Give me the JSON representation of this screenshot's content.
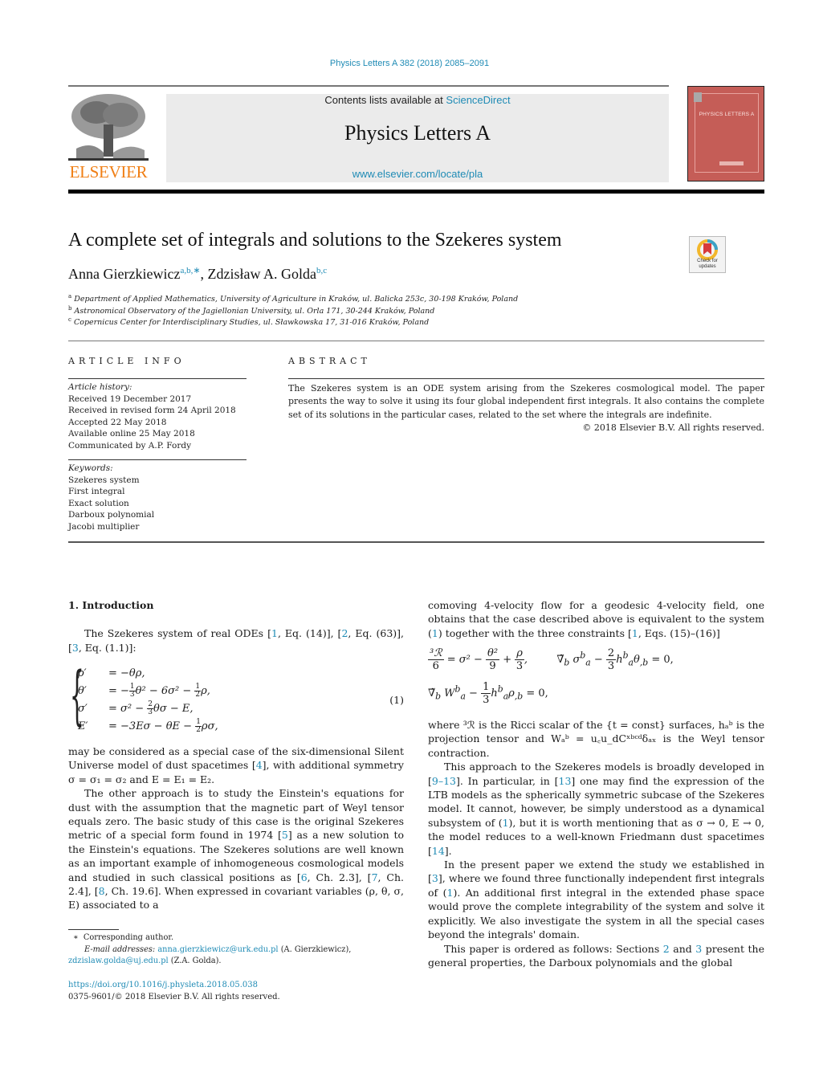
{
  "header": {
    "journal_reference": "Physics Letters A 382 (2018) 2085–2091",
    "contents_prefix": "Contents lists available at ",
    "contents_link": "ScienceDirect",
    "journal_name": "Physics Letters A",
    "journal_url": "www.elsevier.com/locate/pla",
    "publisher_logo_text": "ELSEVIER",
    "cover_title": "PHYSICS LETTERS A",
    "check_updates_label": "Check for updates"
  },
  "article": {
    "title": "A complete set of integrals and solutions to the Szekeres system",
    "authors": [
      {
        "name": "Anna Gierzkiewicz",
        "affiliations": "a,b,∗"
      },
      {
        "name": "Zdzisław A. Golda",
        "affiliations": "b,c"
      }
    ],
    "author_separator": ", ",
    "affiliations": [
      {
        "key": "a",
        "text": "Department of Applied Mathematics, University of Agriculture in Kraków, ul. Balicka 253c, 30-198 Kraków, Poland"
      },
      {
        "key": "b",
        "text": "Astronomical Observatory of the Jagiellonian University, ul. Orla 171, 30-244 Kraków, Poland"
      },
      {
        "key": "c",
        "text": "Copernicus Center for Interdisciplinary Studies, ul. Sławkowska 17, 31-016 Kraków, Poland"
      }
    ]
  },
  "article_info": {
    "heading": "ARTICLE INFO",
    "history_label": "Article history:",
    "history": [
      "Received 19 December 2017",
      "Received in revised form 24 April 2018",
      "Accepted 22 May 2018",
      "Available online 25 May 2018",
      "Communicated by A.P. Fordy"
    ],
    "keywords_label": "Keywords:",
    "keywords": [
      "Szekeres system",
      "First integral",
      "Exact solution",
      "Darboux polynomial",
      "Jacobi multiplier"
    ]
  },
  "abstract": {
    "heading": "ABSTRACT",
    "text": "The Szekeres system is an ODE system arising from the Szekeres cosmological model. The paper presents the way to solve it using its four global independent first integrals. It also contains the complete set of its solutions in the particular cases, related to the set where the integrals are indefinite.",
    "copyright": "© 2018 Elsevier B.V. All rights reserved."
  },
  "body": {
    "section_heading": "1. Introduction",
    "p1_before": "The Szekeres system of real ODEs [",
    "p1_ref1": "1",
    "p1_mid1": ", Eq. (14)], [",
    "p1_ref2": "2",
    "p1_mid2": ", Eq. (63)], [",
    "p1_ref3": "3",
    "p1_after": ", Eq. (1.1)]:",
    "equation_system": {
      "rows": [
        {
          "lhs": "ρ′",
          "rhs": "= −θρ,"
        },
        {
          "lhs": "θ′",
          "rhs_parts": [
            "= −",
            "1",
            "3",
            "θ² − 6σ² − ",
            "1",
            "2",
            "ρ,"
          ]
        },
        {
          "lhs": "σ′",
          "rhs_parts": [
            "= σ² − ",
            "2",
            "3",
            "θσ − E,"
          ]
        },
        {
          "lhs": "E′",
          "rhs_parts": [
            "= −3Eσ − θE − ",
            "1",
            "2",
            "ρσ,"
          ]
        }
      ],
      "number": "(1)"
    },
    "p2_a": "may be considered as a special case of the six-dimensional Silent Universe model of dust spacetimes [",
    "p2_ref": "4",
    "p2_b": "], with additional symmetry σ = σ₁ = σ₂ and E = E₁ = E₂.",
    "p3_a": "The other approach is to study the Einstein's equations for dust with the assumption that the magnetic part of Weyl tensor equals zero. The basic study of this case is the original Szekeres metric of a special form found in 1974 [",
    "p3_ref5": "5",
    "p3_b": "] as a new solution to the Einstein's equations. The Szekeres solutions are well known as an important example of inhomogeneous cosmological models and studied in such classical positions as [",
    "p3_ref6": "6",
    "p3_c": ", Ch. 2.3], [",
    "p3_ref7": "7",
    "p3_d": ", Ch. 2.4], [",
    "p3_ref8": "8",
    "p3_e": ", Ch. 19.6]. When expressed in covariant variables (ρ, θ, σ, E) associated to a",
    "r1_a": "comoving 4-velocity flow for a geodesic 4-velocity field, one obtains that the case described above is equivalent to the system (",
    "r1_ref": "1",
    "r1_b": ") together with the three constraints [",
    "r1_ref2": "1",
    "r1_c": ", Eqs. (15)–(16)]",
    "constraint1_parts": [
      "³ℛ",
      "6",
      "= σ² − ",
      "θ²",
      "9",
      " + ",
      "ρ",
      "3",
      ","
    ],
    "constraint2_parts": [
      "∇̃",
      "b",
      " σ",
      "a",
      "b",
      " − ",
      "2",
      "3",
      "h",
      "a",
      "b",
      "θ",
      ",b",
      " = 0,"
    ],
    "constraint3_parts": [
      "∇̃",
      "b",
      " W",
      "a",
      "b",
      " − ",
      "1",
      "3",
      "h",
      "a",
      "b",
      "ρ",
      ",b",
      " = 0,"
    ],
    "r2": "where ³ℛ is the Ricci scalar of the {t = const} surfaces, hₐᵇ is the projection tensor and Wₐᵇ = u꜀u_dCˣᵇᶜᵈδₐₓ is the Weyl tensor contraction.",
    "r3_a": "This approach to the Szekeres models is broadly developed in [",
    "r3_ref1": "9–13",
    "r3_b": "]. In particular, in [",
    "r3_ref2": "13",
    "r3_c": "] one may find the expression of the LTB models as the spherically symmetric subcase of the Szekeres model. It cannot, however, be simply understood as a dynamical subsystem of (",
    "r3_ref3": "1",
    "r3_d": "), but it is worth mentioning that as σ → 0, E → 0, the model reduces to a well-known Friedmann dust spacetimes [",
    "r3_ref4": "14",
    "r3_e": "].",
    "r4_a": "In the present paper we extend the study we established in [",
    "r4_ref1": "3",
    "r4_b": "], where we found three functionally independent first integrals of (",
    "r4_ref2": "1",
    "r4_c": "). An additional first integral in the extended phase space would prove the complete integrability of the system and solve it explicitly. We also investigate the system in all the special cases beyond the integrals' domain.",
    "r5_a": "This paper is ordered as follows: Sections ",
    "r5_ref1": "2",
    "r5_b": " and ",
    "r5_ref2": "3",
    "r5_c": " present the general properties, the Darboux polynomials and the global"
  },
  "footnotes": {
    "star": "∗",
    "corresponding": "Corresponding author.",
    "email_label": "E-mail addresses:",
    "email1": "anna.gierzkiewicz@urk.edu.pl",
    "email1_name": " (A. Gierzkiewicz),",
    "email2": "zdzislaw.golda@uj.edu.pl",
    "email2_name": " (Z.A. Golda)."
  },
  "doi": {
    "link": "https://doi.org/10.1016/j.physleta.2018.05.038",
    "issn_line": "0375-9601/© 2018 Elsevier B.V. All rights reserved."
  },
  "colors": {
    "link": "#1f8bb5",
    "elsevier_orange": "#f07f15",
    "cover_red": "#c55d57",
    "masthead_gray": "#ebebeb"
  }
}
